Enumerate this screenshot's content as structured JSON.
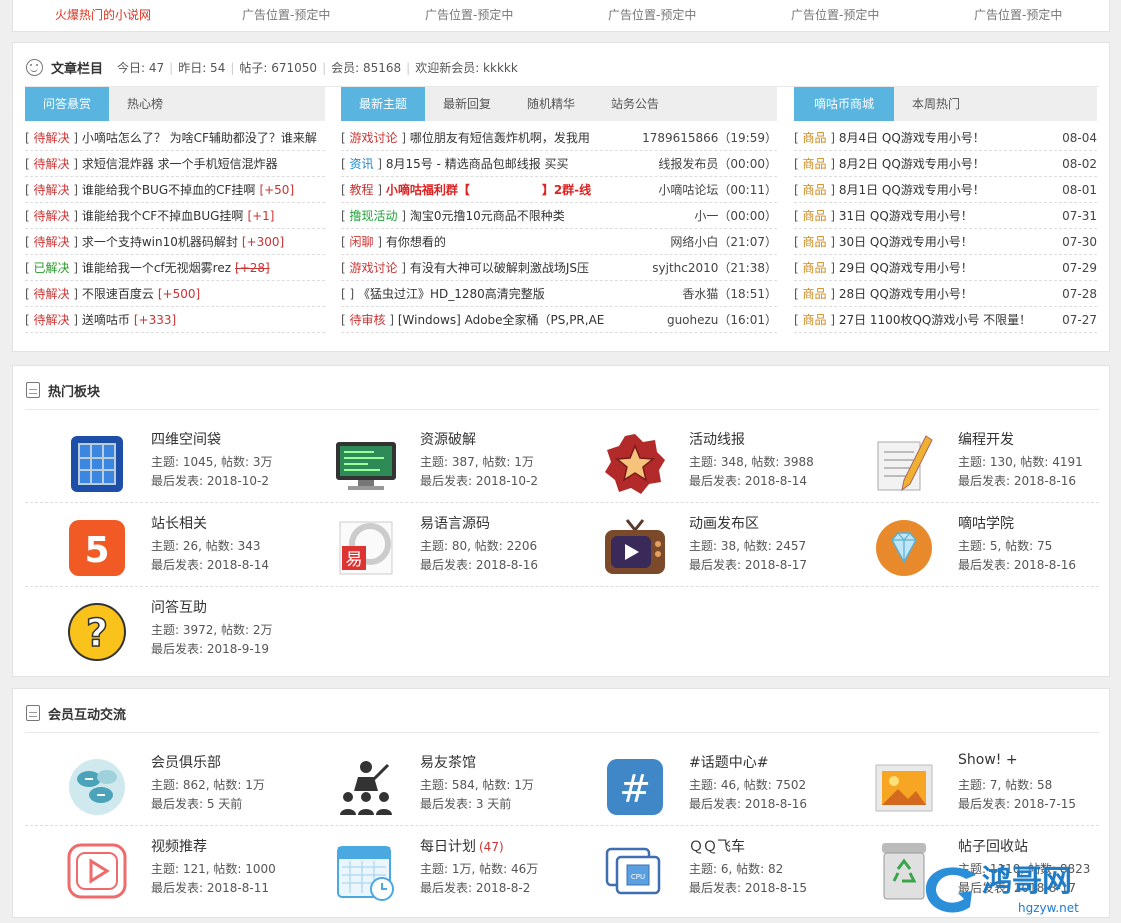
{
  "top_ads": [
    "火爆热门的小说网",
    "广告位置-预定中",
    "广告位置-预定中",
    "广告位置-预定中",
    "广告位置-预定中",
    "广告位置-预定中"
  ],
  "articles": {
    "title": "文章栏目",
    "stats": [
      "今日: 47",
      "昨日: 54",
      "帖子: 671050",
      "会员: 85168",
      "欢迎新会员: kkkkk"
    ],
    "col1": {
      "tabs": [
        "问答悬赏",
        "热心榜"
      ],
      "items": [
        {
          "tag": "待解决",
          "title": "小嘀咕怎么了？ 为啥CF辅助都没了？谁来解",
          "bounty": ""
        },
        {
          "tag": "待解决",
          "title": "求短信混炸器 求一个手机短信混炸器",
          "bounty": ""
        },
        {
          "tag": "待解决",
          "title": "谁能给我个BUG不掉血的CF挂啊",
          "bounty": "[+50]"
        },
        {
          "tag": "待解决",
          "title": "谁能给我个CF不掉血BUG挂啊",
          "bounty": "[+1]"
        },
        {
          "tag": "待解决",
          "title": "求一个支持win10机器码解封",
          "bounty": "[+300]"
        },
        {
          "tag": "已解决",
          "title": "谁能给我一个cf无视烟雾rez",
          "bounty": "[+28]"
        },
        {
          "tag": "待解决",
          "title": "不限速百度云",
          "bounty": "[+500]"
        },
        {
          "tag": "待解决",
          "title": "送嘀咕币",
          "bounty": "[+333]"
        }
      ]
    },
    "col2": {
      "tabs": [
        "最新主题",
        "最新回复",
        "随机精华",
        "站务公告"
      ],
      "items": [
        {
          "tag": "游戏讨论",
          "title": "哪位朋友有短信轰炸机啊，发我用",
          "right": "1789615866（19:59）"
        },
        {
          "tag": "资讯",
          "title": "8月15号 - 精选商品包邮线报 买买",
          "right": "线报发布员（00:00）"
        },
        {
          "tag": "教程",
          "title": "小嘀咕福利群【　　　　　　】2群-线",
          "right": "小嘀咕论坛（00:11）"
        },
        {
          "tag": "撸现活动",
          "title": "淘宝0元撸10元商品不限种类",
          "right": "小一（00:00）"
        },
        {
          "tag": "闲聊",
          "title": "有你想看的",
          "right": "网络小白（21:07）"
        },
        {
          "tag": "游戏讨论",
          "title": "有没有大神可以破解刺激战场JS压",
          "right": "syjthc2010（21:38）"
        },
        {
          "tag": "",
          "title": "《猛虫过江》HD_1280高清完整版",
          "right": "香水猫（18:51）"
        },
        {
          "tag": "待审核",
          "title": "[Windows] Adobe全家桶（PS,PR,AE",
          "right": "guohezu（16:01）"
        }
      ]
    },
    "col3": {
      "tabs": [
        "嘀咕币商城",
        "本周热门"
      ],
      "items": [
        {
          "tag": "商品",
          "title": "8月4日 QQ游戏专用小号！",
          "right": "08-04"
        },
        {
          "tag": "商品",
          "title": "8月2日 QQ游戏专用小号！",
          "right": "08-02"
        },
        {
          "tag": "商品",
          "title": "8月1日 QQ游戏专用小号！",
          "right": "08-01"
        },
        {
          "tag": "商品",
          "title": "31日 QQ游戏专用小号！",
          "right": "07-31"
        },
        {
          "tag": "商品",
          "title": "30日 QQ游戏专用小号！",
          "right": "07-30"
        },
        {
          "tag": "商品",
          "title": "29日 QQ游戏专用小号！",
          "right": "07-29"
        },
        {
          "tag": "商品",
          "title": "28日 QQ游戏专用小号！",
          "right": "07-28"
        },
        {
          "tag": "商品",
          "title": "27日 1100枚QQ游戏小号 不限量！",
          "right": "07-27"
        }
      ]
    }
  },
  "hot": {
    "title": "热门板块",
    "forums": [
      {
        "name": "四维空间袋",
        "stats": "主题: 1045, 帖数: 3万",
        "last": "最后发表: 2018-10-2",
        "icon": "storage-icon"
      },
      {
        "name": "资源破解",
        "stats": "主题: 387, 帖数: 1万",
        "last": "最后发表: 2018-10-2",
        "icon": "monitor-icon"
      },
      {
        "name": "活动线报",
        "stats": "主题: 348, 帖数: 3988",
        "last": "最后发表: 2018-8-14",
        "icon": "star-badge-icon"
      },
      {
        "name": "编程开发",
        "stats": "主题: 130, 帖数: 4191",
        "last": "最后发表: 2018-8-16",
        "icon": "pencil-paper-icon"
      },
      {
        "name": "站长相关",
        "stats": "主题: 26, 帖数: 343",
        "last": "最后发表: 2018-8-14",
        "icon": "html5-icon"
      },
      {
        "name": "易语言源码",
        "stats": "主题: 80, 帖数: 2206",
        "last": "最后发表: 2018-8-16",
        "icon": "yi-logo-icon"
      },
      {
        "name": "动画发布区",
        "stats": "主题: 38, 帖数: 2457",
        "last": "最后发表: 2018-8-17",
        "icon": "tv-play-icon"
      },
      {
        "name": "嘀咕学院",
        "stats": "主题: 5, 帖数: 75",
        "last": "最后发表: 2018-8-16",
        "icon": "diamond-icon"
      },
      {
        "name": "问答互助",
        "stats": "主题: 3972, 帖数: 2万",
        "last": "最后发表: 2018-9-19",
        "icon": "question-icon"
      }
    ]
  },
  "members": {
    "title": "会员互动交流",
    "forums": [
      {
        "name": "会员俱乐部",
        "count": "",
        "stats": "主题: 862, 帖数: 1万",
        "last": "最后发表: 5 天前",
        "icon": "chat-bubbles-icon"
      },
      {
        "name": "易友茶馆",
        "count": "",
        "stats": "主题: 584, 帖数: 1万",
        "last": "最后发表: 3 天前",
        "icon": "group-meeting-icon"
      },
      {
        "name": "#话题中心#",
        "count": "",
        "stats": "主题: 46, 帖数: 7502",
        "last": "最后发表: 2018-8-16",
        "icon": "hashtag-icon"
      },
      {
        "name": "Show! +",
        "count": "",
        "stats": "主题: 7, 帖数: 58",
        "last": "最后发表: 2018-7-15",
        "icon": "picture-icon"
      },
      {
        "name": "视频推荐",
        "count": "",
        "stats": "主题: 121, 帖数: 1000",
        "last": "最后发表: 2018-8-11",
        "icon": "video-play-icon"
      },
      {
        "name": "每日计划",
        "count": "(47)",
        "stats": "主题: 1万, 帖数: 46万",
        "last": "最后发表: 2018-8-2",
        "icon": "calendar-icon"
      },
      {
        "name": "ＱＱ飞车",
        "count": "",
        "stats": "主题: 6, 帖数: 82",
        "last": "最后发表: 2018-8-15",
        "icon": "cpu-icon"
      },
      {
        "name": "帖子回收站",
        "count": "",
        "stats": "主题: 1110, 帖数: 8823",
        "last": "最后发表: 2018-8-17",
        "icon": "recycle-bin-icon"
      }
    ]
  },
  "watermark": {
    "brand": "鸿哥网",
    "url": "hgzyw.net"
  }
}
